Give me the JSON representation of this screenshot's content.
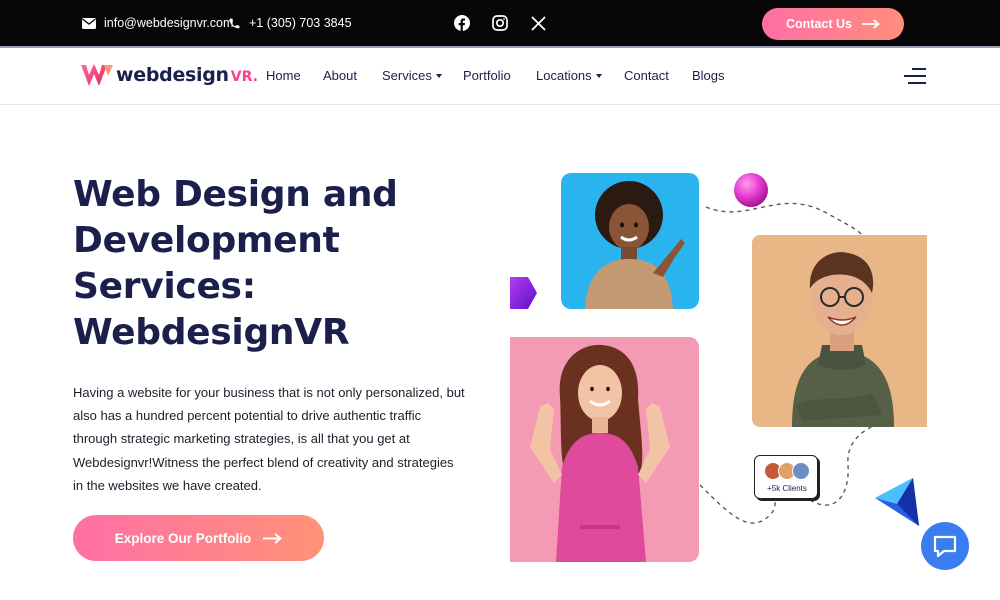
{
  "topbar": {
    "email": "info@webdesignvr.com",
    "phone": "+1 (305) 703 3845",
    "contact_button": "Contact Us",
    "social_icons": [
      "facebook-icon",
      "instagram-icon",
      "x-icon"
    ]
  },
  "navbar": {
    "logo_main": "webdesign",
    "logo_suffix": "VR.",
    "links": [
      {
        "label": "Home",
        "dropdown": false
      },
      {
        "label": "About",
        "dropdown": false
      },
      {
        "label": "Services",
        "dropdown": true
      },
      {
        "label": "Portfolio",
        "dropdown": false
      },
      {
        "label": "Locations",
        "dropdown": true
      },
      {
        "label": "Contact",
        "dropdown": false
      },
      {
        "label": "Blogs",
        "dropdown": false
      }
    ]
  },
  "hero": {
    "title_lines": [
      "Web Design and",
      "Development",
      "Services:",
      "WebdesignVR"
    ],
    "description_lines": [
      "Having a website for your business that is not only personalized, but",
      "also has a hundred percent potential to drive authentic traffic",
      "through strategic marketing strategies, is all that you get at",
      "Webdesignvr!Witness the perfect blend of creativity and strategies",
      "in the websites we have created."
    ],
    "cta_button": "Explore Our Portfolio"
  },
  "clients_badge": {
    "label": "+5k Clients"
  },
  "colors": {
    "primary_navy": "#1b1f4b",
    "accent_pink": "#ff6fa6",
    "accent_coral": "#ff9277",
    "chat_blue": "#3a7df0"
  }
}
